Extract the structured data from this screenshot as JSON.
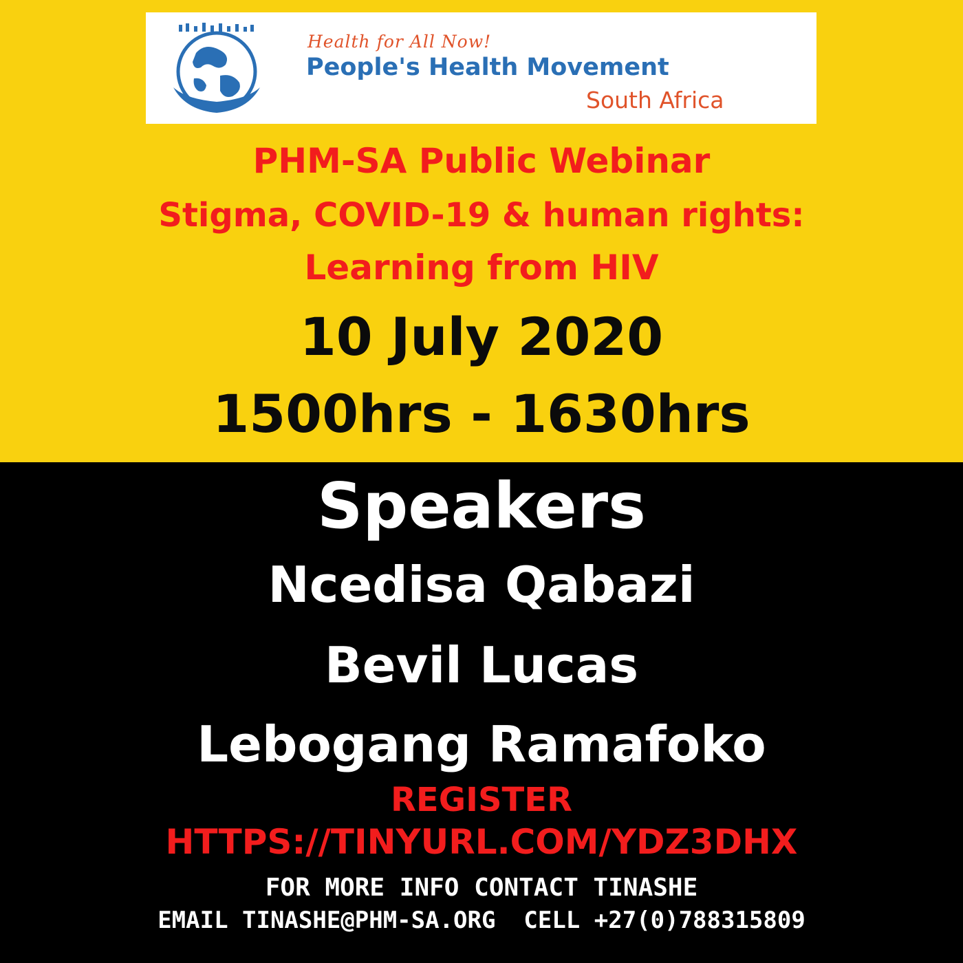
{
  "logo": {
    "tagline": "Health for All Now!",
    "name": "People's Health Movement",
    "region": "South Africa",
    "colors": {
      "globe": "#2a6fb5",
      "accent": "#e0532a"
    }
  },
  "event": {
    "title": "PHM-SA Public Webinar",
    "subtitle_line1": "Stigma, COVID-19 & human rights:",
    "subtitle_line2": "Learning from HIV",
    "date": "10 July 2020",
    "time": "1500hrs - 1630hrs"
  },
  "speakers": {
    "heading": "Speakers",
    "names": [
      "Ncedisa Qabazi",
      "Bevil Lucas",
      "Lebogang Ramafoko"
    ]
  },
  "register": {
    "label": "REGISTER",
    "url": "HTTPS://TINYURL.COM/YDZ3DHX"
  },
  "contact": {
    "line1": "FOR MORE INFO CONTACT TINASHE",
    "line2": "EMAIL TINASHE@PHM-SA.ORG  CELL +27(0)788315809"
  },
  "colors": {
    "top_band": "#f9d10f",
    "bottom_band": "#000000",
    "red_text": "#f21d1d"
  }
}
